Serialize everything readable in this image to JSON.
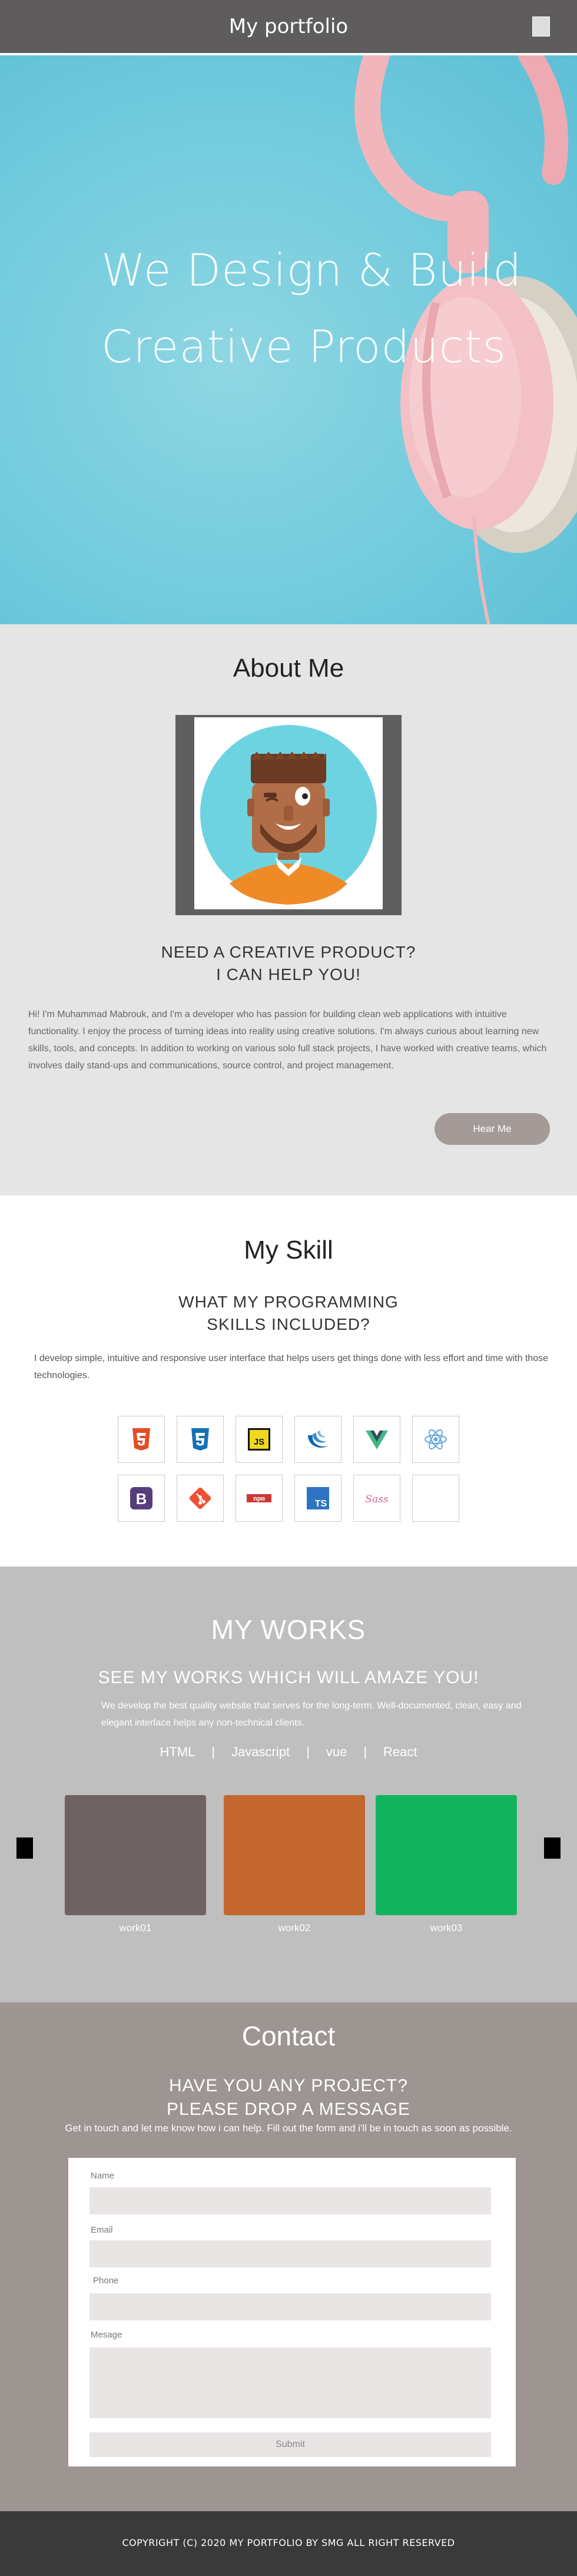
{
  "header": {
    "title": "My portfolio",
    "menu_icon": "menu-icon"
  },
  "hero": {
    "line1": "We Design & Build",
    "line2": "Creative Products",
    "image": "headphones-illustration"
  },
  "about": {
    "title": "About Me",
    "avatar": "developer-avatar",
    "subtitle_line1": "NEED A CREATIVE PRODUCT?",
    "subtitle_line2": "I CAN HELP YOU!",
    "paragraph": "Hi! I'm Muhammad Mabrouk, and I'm a developer who has passion for building clean web applications with intuitive functionality. I enjoy the process of turning ideas into reality using creative solutions. I'm always curious about learning new skills, tools, and concepts. In addition to working on various solo full stack projects, I have worked with creative teams, which involves daily stand-ups and communications, source control, and project management.",
    "button": "Hear Me"
  },
  "skill": {
    "title": "My Skill",
    "subtitle_line1": "WHAT MY PROGRAMMING",
    "subtitle_line2": "SKILLS INCLUDED?",
    "paragraph": "I develop simple, intuitive and responsive user interface that helps users get things done with less effort and time with those technologies.",
    "icons": [
      "html5-icon",
      "css3-icon",
      "javascript-icon",
      "jquery-icon",
      "vue-icon",
      "react-icon",
      "bootstrap-icon",
      "git-icon",
      "npm-icon",
      "typescript-icon",
      "sass-icon",
      "empty-icon"
    ]
  },
  "works": {
    "title": "MY WORKS",
    "subtitle": "SEE MY WORKS WHICH WILL AMAZE YOU!",
    "paragraph": "We develop the best quality website that serves for the long-term. Well-documented, clean, easy and elegant interface helps any non-technical clients.",
    "filters": [
      "HTML",
      "Javascript",
      "vue",
      "React"
    ],
    "separator": "|",
    "items": [
      {
        "label": "work01",
        "color": "#6e6262"
      },
      {
        "label": "work02",
        "color": "#c3672e"
      },
      {
        "label": "work03",
        "color": "#12b35d"
      }
    ]
  },
  "contact": {
    "title": "Contact",
    "subtitle_line1": "HAVE YOU ANY PROJECT?",
    "subtitle_line2": "PLEASE DROP A MESSAGE",
    "paragraph": "Get in touch and let me know how i can help. Fill out the form and i'll be in touch as soon as possible.",
    "fields": {
      "name": "Name",
      "email": "Email",
      "phone": "Phone",
      "message": "Mesage"
    },
    "submit": "Submit"
  },
  "footer": {
    "copyright": "COPYRIGHT (C) 2020 MY PORTFOLIO BY SMG ALL RIGHT RESERVED"
  }
}
